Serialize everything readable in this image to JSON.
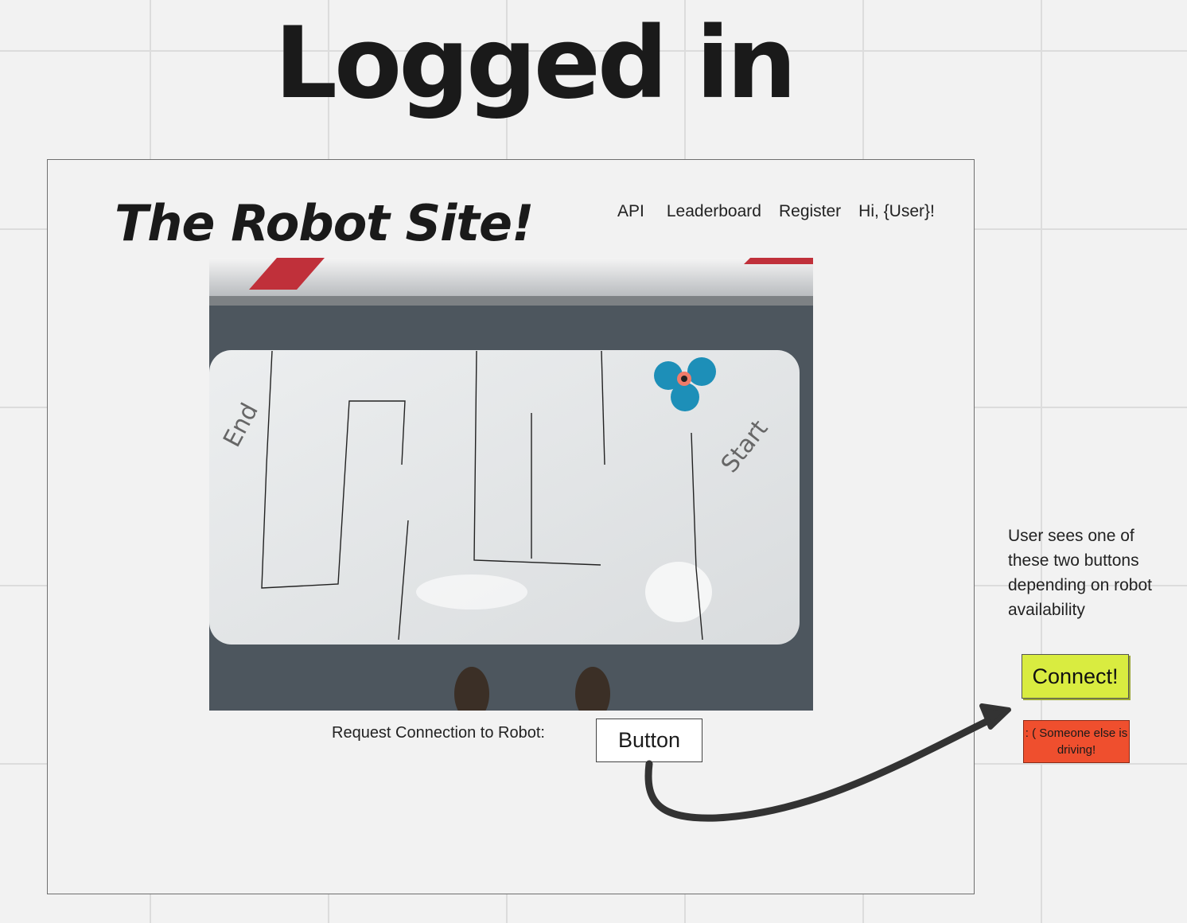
{
  "board": {
    "title": "Logged in"
  },
  "site": {
    "title": "The Robot Site!",
    "nav": [
      "API",
      "Leaderboard",
      "Register",
      "Hi, {User}!"
    ]
  },
  "photo": {
    "labels": {
      "end": "End",
      "start": "Start"
    }
  },
  "request": {
    "label": "Request Connection to Robot:",
    "button": "Button"
  },
  "note": "User sees one of these two buttons depending on robot availability",
  "connect": {
    "label": "Connect!"
  },
  "busy": {
    "label": ": ( Someone else is driving!"
  },
  "colors": {
    "connect": "#d9ec40",
    "busy": "#ef4f2e",
    "arrow": "#333333"
  }
}
